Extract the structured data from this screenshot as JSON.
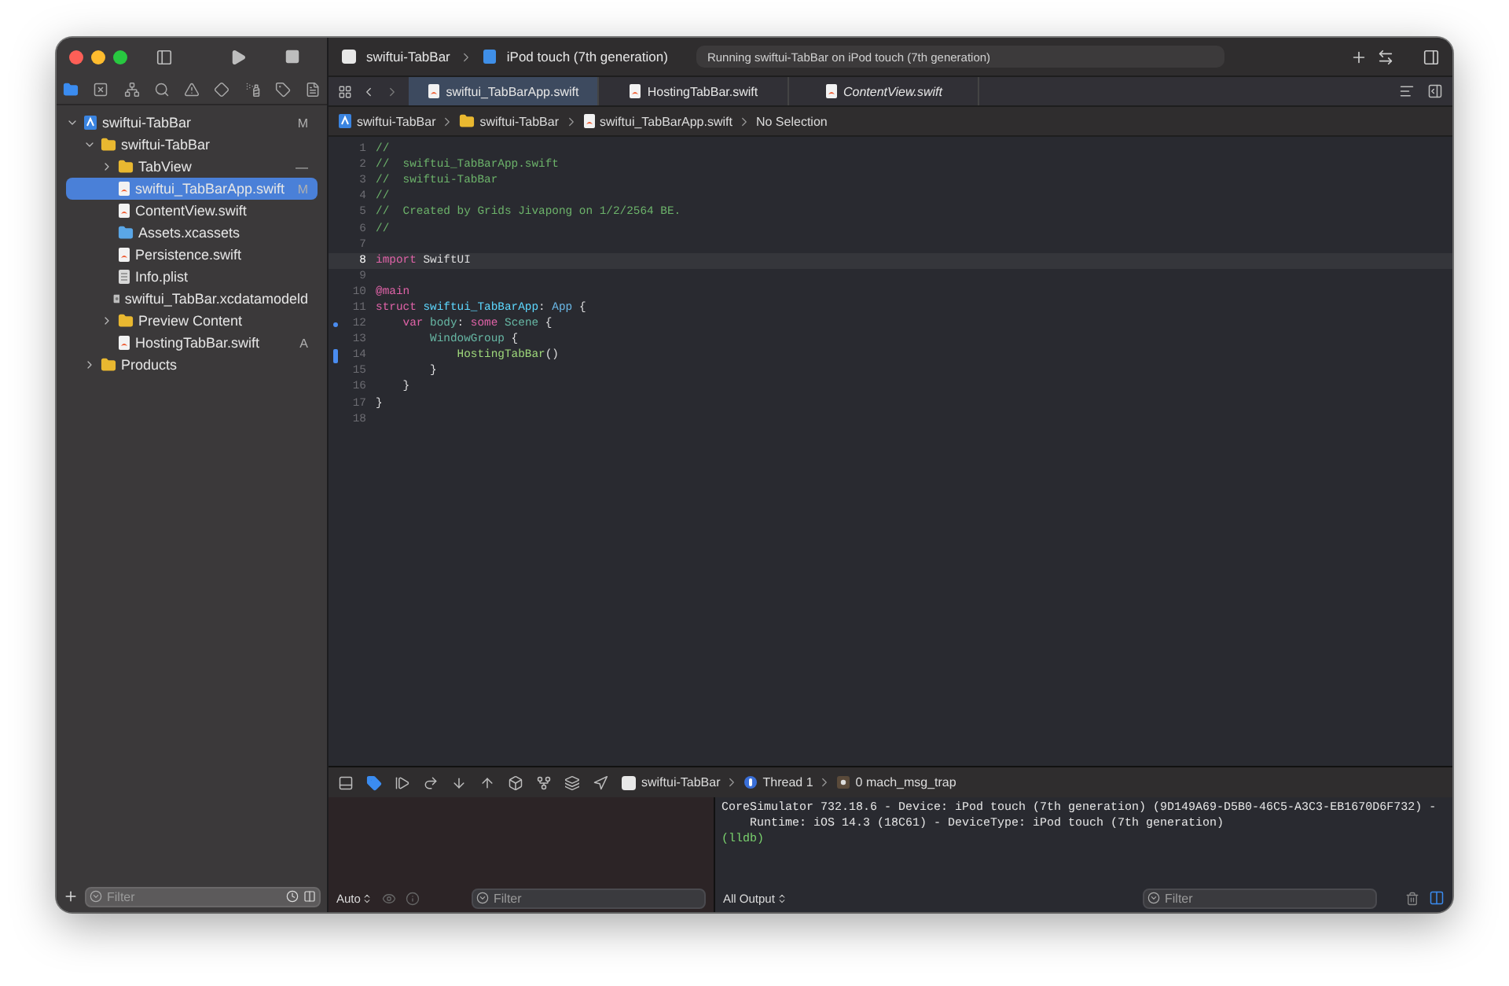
{
  "window": {
    "scheme": "swiftui-TabBar",
    "destination": "iPod touch (7th generation)",
    "activity": "Running swiftui-TabBar on iPod touch (7th generation)"
  },
  "navigator_tabs": [
    {
      "selected": true
    },
    {
      "selected": false
    },
    {
      "selected": false
    },
    {
      "selected": false
    },
    {
      "selected": false
    },
    {
      "selected": false
    },
    {
      "selected": false
    },
    {
      "selected": false
    },
    {
      "selected": false
    }
  ],
  "tree": [
    {
      "name": "swiftui-TabBar",
      "kind": "project",
      "badge": "M",
      "expanded": true,
      "selected": false,
      "children": [
        {
          "name": "swiftui-TabBar",
          "kind": "folder",
          "expanded": true,
          "selected": false,
          "children": [
            {
              "name": "TabView",
              "kind": "folder",
              "badge": "—",
              "expanded": false,
              "selected": false
            },
            {
              "name": "swiftui_TabBarApp.swift",
              "kind": "swift",
              "badge": "M",
              "selected": true
            },
            {
              "name": "ContentView.swift",
              "kind": "swift",
              "selected": false
            },
            {
              "name": "Assets.xcassets",
              "kind": "assets",
              "selected": false
            },
            {
              "name": "Persistence.swift",
              "kind": "swift",
              "selected": false
            },
            {
              "name": "Info.plist",
              "kind": "plist",
              "selected": false
            },
            {
              "name": "swiftui_TabBar.xcdatamodeld",
              "kind": "datamodel",
              "selected": false
            },
            {
              "name": "Preview Content",
              "kind": "folder",
              "expanded": false,
              "selected": false
            },
            {
              "name": "HostingTabBar.swift",
              "kind": "swift",
              "badge": "A",
              "selected": false
            }
          ]
        },
        {
          "name": "Products",
          "kind": "folder",
          "expanded": false,
          "selected": false
        }
      ]
    }
  ],
  "navigator_filter": {
    "placeholder": "Filter"
  },
  "editor_tabs": [
    {
      "label": "swiftui_TabBarApp.swift",
      "selected": true,
      "preview": false
    },
    {
      "label": "HostingTabBar.swift",
      "selected": false,
      "preview": false
    },
    {
      "label": "ContentView.swift",
      "selected": false,
      "preview": true
    }
  ],
  "breadcrumb": [
    {
      "label": "swiftui-TabBar",
      "kind": "project"
    },
    {
      "label": "swiftui-TabBar",
      "kind": "folder"
    },
    {
      "label": "swiftui_TabBarApp.swift",
      "kind": "swift"
    },
    {
      "label": "No Selection",
      "kind": "text"
    }
  ],
  "code": [
    {
      "number": "1",
      "tokens": [
        {
          "kind": "comment",
          "text": "//"
        }
      ]
    },
    {
      "number": "2",
      "tokens": [
        {
          "kind": "comment",
          "text": "//  swiftui_TabBarApp.swift"
        }
      ]
    },
    {
      "number": "3",
      "tokens": [
        {
          "kind": "comment",
          "text": "//  swiftui-TabBar"
        }
      ]
    },
    {
      "number": "4",
      "tokens": [
        {
          "kind": "comment",
          "text": "//"
        }
      ]
    },
    {
      "number": "5",
      "tokens": [
        {
          "kind": "comment",
          "text": "//  Created by Grids Jivapong on 1/2/2564 BE."
        }
      ]
    },
    {
      "number": "6",
      "tokens": [
        {
          "kind": "comment",
          "text": "//"
        }
      ]
    },
    {
      "number": "7"
    },
    {
      "number": "8",
      "current": true,
      "tokens": [
        {
          "kind": "keyword",
          "text": "import"
        },
        {
          "kind": "plain",
          "text": " SwiftUI"
        }
      ]
    },
    {
      "number": "9"
    },
    {
      "number": "10",
      "tokens": [
        {
          "kind": "keyword",
          "text": "@main"
        }
      ]
    },
    {
      "number": "11",
      "tokens": [
        {
          "kind": "keyword",
          "text": "struct"
        },
        {
          "kind": "declared",
          "text": " swiftui_TabBarApp"
        },
        {
          "kind": "plain",
          "text": ": "
        },
        {
          "kind": "type",
          "text": "App"
        },
        {
          "kind": "plain",
          "text": " {"
        }
      ]
    },
    {
      "number": "12",
      "gutter": {
        "kind": "dot"
      },
      "tokens": [
        {
          "kind": "keyword",
          "text": "    var"
        },
        {
          "kind": "project",
          "text": " body"
        },
        {
          "kind": "plain",
          "text": ": "
        },
        {
          "kind": "keyword",
          "text": "some"
        },
        {
          "kind": "project",
          "text": " Scene"
        },
        {
          "kind": "plain",
          "text": " {"
        }
      ]
    },
    {
      "number": "13",
      "tokens": [
        {
          "kind": "project",
          "text": "        WindowGroup"
        },
        {
          "kind": "plain",
          "text": " {"
        }
      ]
    },
    {
      "number": "14",
      "gutter": {
        "kind": "bar"
      },
      "tokens": [
        {
          "kind": "call",
          "text": "            HostingTabBar"
        },
        {
          "kind": "plain",
          "text": "()"
        }
      ]
    },
    {
      "number": "15",
      "tokens": [
        {
          "kind": "plain",
          "text": "        }"
        }
      ]
    },
    {
      "number": "16",
      "tokens": [
        {
          "kind": "plain",
          "text": "    }"
        }
      ]
    },
    {
      "number": "17",
      "tokens": [
        {
          "kind": "plain",
          "text": "}"
        }
      ]
    },
    {
      "number": "18"
    }
  ],
  "debug_path": [
    {
      "label": "swiftui-TabBar",
      "kind": "app"
    },
    {
      "label": "Thread 1",
      "kind": "thread"
    },
    {
      "label": "0 mach_msg_trap",
      "kind": "frame"
    }
  ],
  "variables": {
    "scope": "Auto",
    "filter_placeholder": "Filter"
  },
  "console": {
    "lines": [
      {
        "kind": "output",
        "text": "CoreSimulator 732.18.6 - Device: iPod touch (7th generation) (9D149A69-D5B0-46C5-A3C3-EB1670D6F732) -"
      },
      {
        "kind": "continuation",
        "text": "Runtime: iOS 14.3 (18C61) - DeviceType: iPod touch (7th generation)"
      },
      {
        "kind": "prompt",
        "text": "(lldb)"
      }
    ],
    "output": "All Output",
    "filter_placeholder": "Filter"
  }
}
